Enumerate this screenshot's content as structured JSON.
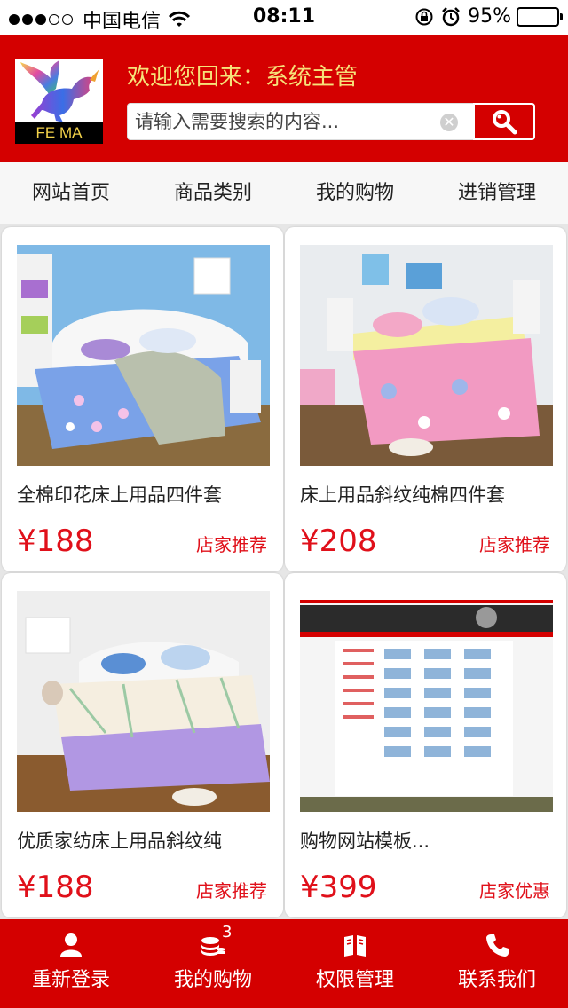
{
  "status_bar": {
    "carrier": "中国电信",
    "time": "08:11",
    "battery": "95%",
    "battery_level": 0.95
  },
  "header": {
    "logo_text": "FE MA",
    "welcome": "欢迎您回来：系统主管",
    "search": {
      "placeholder": "请输入需要搜索的内容...",
      "value": ""
    }
  },
  "nav": {
    "items": [
      "网站首页",
      "商品类别",
      "我的购物",
      "进销管理"
    ]
  },
  "products": [
    {
      "name": "全棉印花床上用品四件套",
      "price": "¥188",
      "tag": "店家推荐"
    },
    {
      "name": "床上用品斜纹纯棉四件套",
      "price": "¥208",
      "tag": "店家推荐"
    },
    {
      "name": "优质家纺床上用品斜纹纯",
      "price": "¥188",
      "tag": "店家推荐"
    },
    {
      "name": "购物网站模板...",
      "price": "¥399",
      "tag": "店家优惠"
    }
  ],
  "footer": {
    "items": [
      {
        "label": "重新登录",
        "icon": "user-icon"
      },
      {
        "label": "我的购物",
        "icon": "coins-icon",
        "badge": "3"
      },
      {
        "label": "权限管理",
        "icon": "book-icon"
      },
      {
        "label": "联系我们",
        "icon": "phone-icon"
      }
    ]
  },
  "colors": {
    "primary": "#d40000",
    "price": "#e0101a",
    "welcome": "#f6e27a"
  }
}
